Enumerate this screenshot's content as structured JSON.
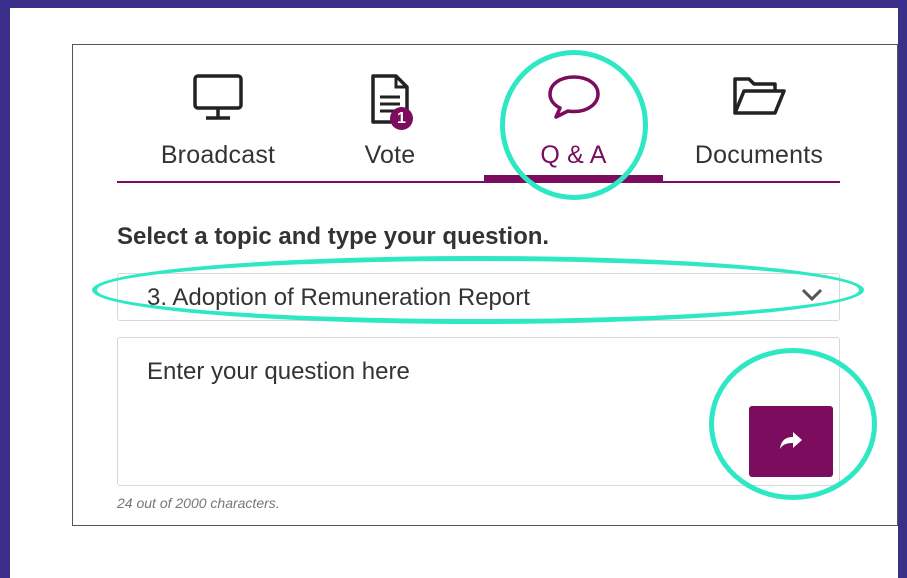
{
  "tabs": [
    {
      "label": "Broadcast",
      "icon": "monitor-icon"
    },
    {
      "label": "Vote",
      "icon": "document-icon",
      "badge": "1"
    },
    {
      "label": "Q & A",
      "icon": "speech-bubble-icon",
      "active": true
    },
    {
      "label": "Documents",
      "icon": "folder-open-icon"
    }
  ],
  "qa": {
    "instruction": "Select a topic and type your question.",
    "topic_selected": "3. Adoption of Remuneration Report",
    "question_placeholder": "Enter your question here",
    "char_count": "24 out of 2000  characters."
  },
  "colors": {
    "accent": "#7b0c5e",
    "annotation": "#2ee8c4",
    "outer_background": "#3b2f8a"
  }
}
